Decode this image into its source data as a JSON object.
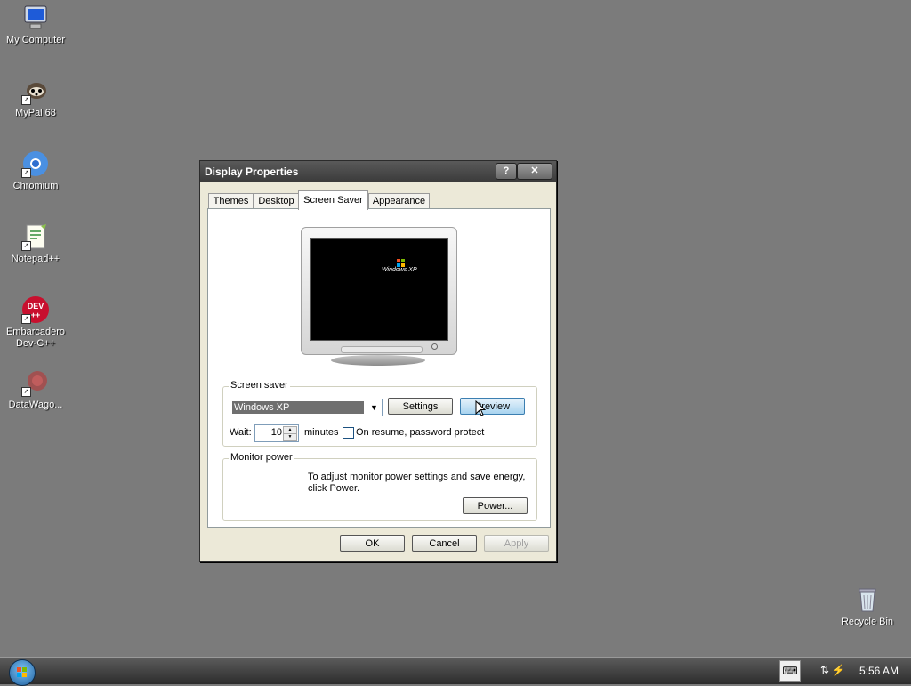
{
  "desktop": {
    "icons": [
      {
        "label": "My Computer",
        "icon": "computer-icon"
      },
      {
        "label": "MyPal 68",
        "icon": "raccoon-icon"
      },
      {
        "label": "Chromium",
        "icon": "chromium-icon"
      },
      {
        "label": "Notepad++",
        "icon": "notepad-icon"
      },
      {
        "label": "Embarcadero Dev-C++",
        "icon": "devcpp-icon"
      },
      {
        "label": "DataWago...",
        "icon": "datawago-icon"
      },
      {
        "label": "Recycle Bin",
        "icon": "recycle-bin-icon"
      }
    ]
  },
  "dialog": {
    "title": "Display Properties",
    "help_label": "?",
    "close_label": "✕",
    "tabs": [
      "Themes",
      "Desktop",
      "Screen Saver",
      "Appearance"
    ],
    "active_tab": "Screen Saver",
    "preview_logo": "Windows XP",
    "screensaver_group": {
      "label": "Screen saver",
      "selected": "Windows XP",
      "settings_label": "Settings",
      "preview_label": "Preview",
      "wait_label": "Wait:",
      "wait_value": "10",
      "minutes_label": "minutes",
      "password_label": "On resume, password protect",
      "password_checked": false
    },
    "monitor_group": {
      "label": "Monitor power",
      "text": "To adjust monitor power settings and save energy, click Power.",
      "power_label": "Power..."
    },
    "buttons": {
      "ok": "OK",
      "cancel": "Cancel",
      "apply": "Apply"
    }
  },
  "taskbar": {
    "clock": "5:56 AM",
    "keyboard_icon": "⌨"
  },
  "colors": {
    "desktop": "#7b7b7b",
    "dialog_bg": "#ece9d8",
    "titlebar": "#4a4a4a"
  }
}
